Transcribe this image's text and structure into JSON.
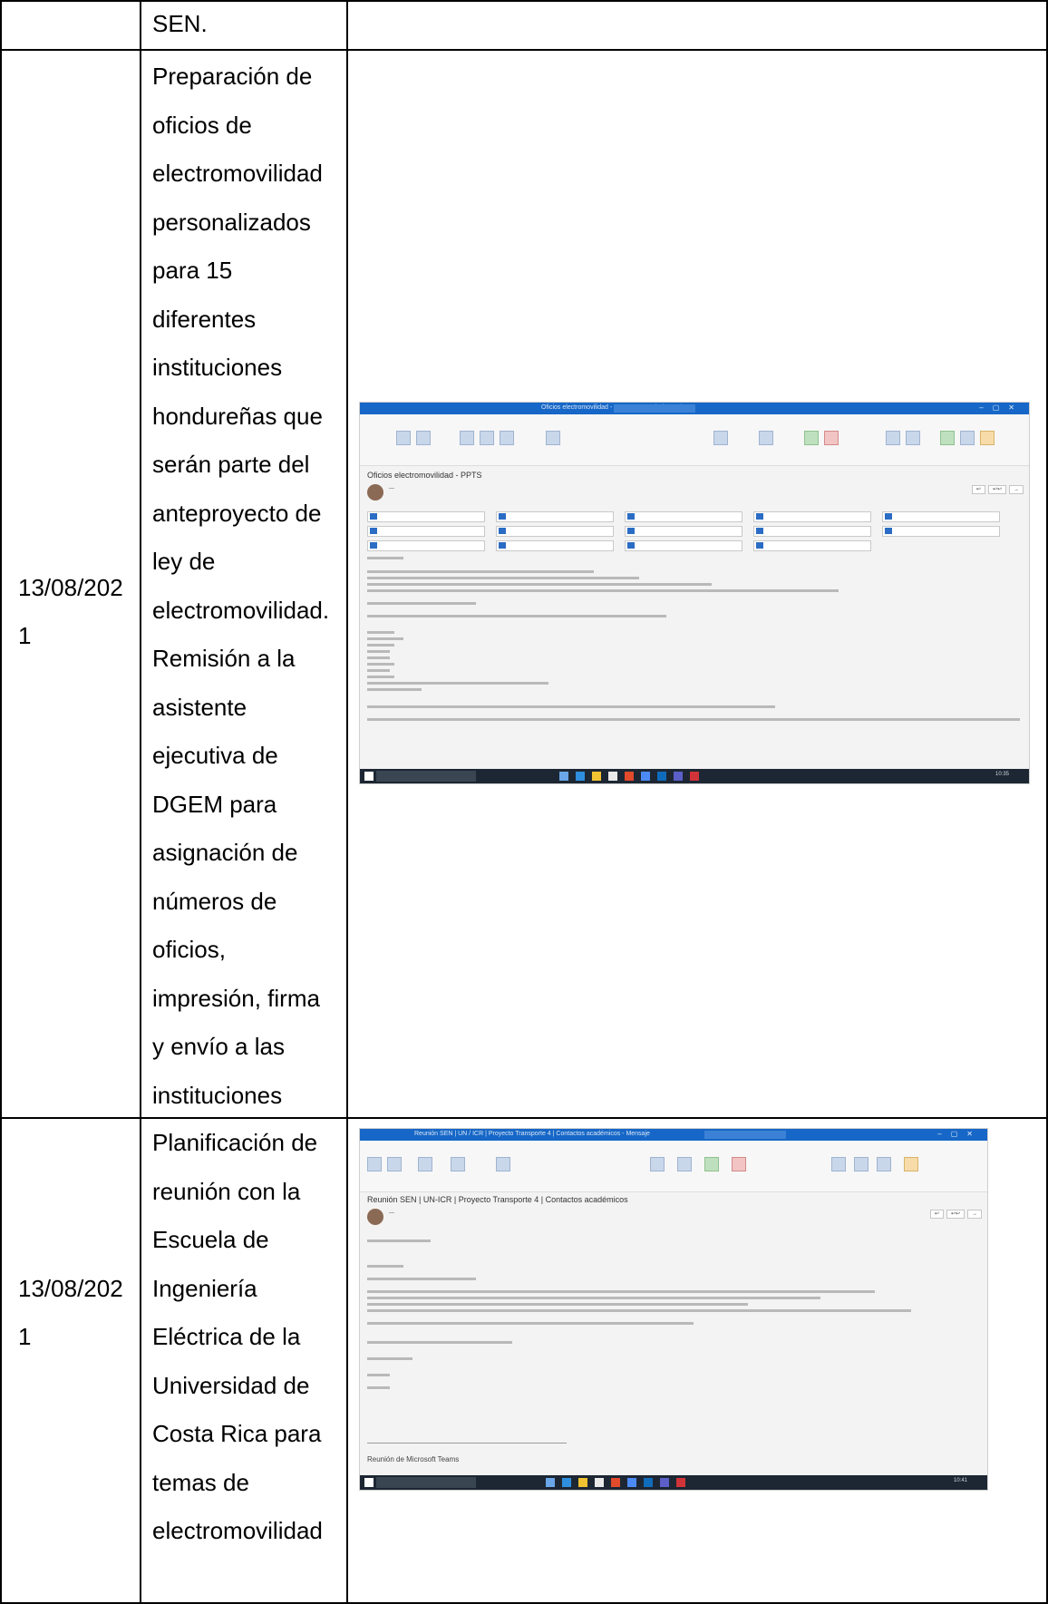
{
  "rows": [
    {
      "date": "",
      "description_lines": [
        "SEN."
      ]
    },
    {
      "date_lines": [
        "13/08/202",
        "1"
      ],
      "description_lines": [
        "Preparación de",
        "oficios de",
        "electromovilidad",
        "personalizados",
        "para 15",
        "diferentes",
        "instituciones",
        "hondureñas que",
        "serán parte del",
        "anteproyecto de",
        "ley de",
        "electromovilidad.",
        "Remisión a la",
        "asistente",
        "ejecutiva de",
        "DGEM para",
        "asignación de",
        "números de",
        "oficios,",
        "impresión, firma",
        "y envío a las",
        "instituciones"
      ],
      "evidence": {
        "window_title": "Oficios electromovilidad - PPTS - Mensaje (HTML)",
        "search_hint": "Buscar",
        "subject": "Oficios electromovilidad - PPTS",
        "taskbar_search": "Escribe aquí para buscar",
        "clock": "10:35"
      }
    },
    {
      "date_lines": [
        "13/08/202",
        "1"
      ],
      "description_lines": [
        "Planificación de",
        "reunión con la",
        "Escuela de",
        "Ingeniería",
        "Eléctrica de la",
        "Universidad de",
        "Costa Rica para",
        "temas de",
        "electromovilidad"
      ],
      "evidence": {
        "window_title": "Reunión SEN | UN / ICR | Proyecto Transporte 4 | Contactos académicos - Mensaje",
        "search_hint": "Buscar",
        "subject": "Reunión SEN | UN-ICR | Proyecto Transporte 4 | Contactos académicos",
        "teams_heading": "Reunión de Microsoft Teams",
        "taskbar_search": "Escribe aquí para buscar",
        "clock": "10:41"
      }
    }
  ]
}
